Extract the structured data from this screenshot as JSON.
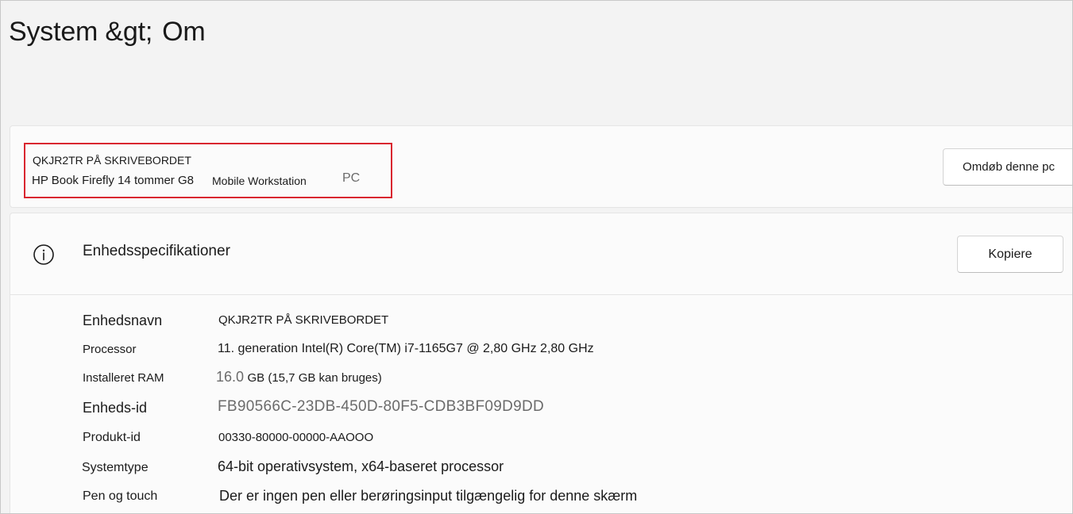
{
  "page": {
    "title_prefix": "System &gt;",
    "title_current": "Om"
  },
  "device": {
    "name": "QKJR2TR PÅ SKRIVEBORDET",
    "model": "HP Book Firefly 14 tommer G8",
    "variant": "Mobile Workstation",
    "type": "PC",
    "rename_button": "Omdøb denne pc",
    "highlight_color": "#d9262f"
  },
  "specs": {
    "icon": "info-icon",
    "title": "Enhedsspecifikationer",
    "copy_button": "Kopiere",
    "rows": [
      {
        "label": "Enhedsnavn",
        "value": "QKJR2TR PÅ SKRIVEBORDET"
      },
      {
        "label": "Processor",
        "value": "11. generation Intel(R) Core(TM) i7-1165G7 @ 2,80 GHz 2,80 GHz"
      },
      {
        "label": "Installeret  RAM",
        "value_main": "16.0",
        "value_rest": "GB (15,7 GB kan bruges)"
      },
      {
        "label": "Enheds-id",
        "value": "FB90566C-23DB-450D-80F5-CDB3BF09D9DD"
      },
      {
        "label": "Produkt-id",
        "value": "00330-80000-00000-AAOOO"
      },
      {
        "label": "Systemtype",
        "value": "64-bit operativsystem, x64-baseret processor"
      },
      {
        "label": "Pen og touch",
        "value": "Der er ingen pen eller berøringsinput tilgængelig for denne skærm"
      }
    ]
  }
}
